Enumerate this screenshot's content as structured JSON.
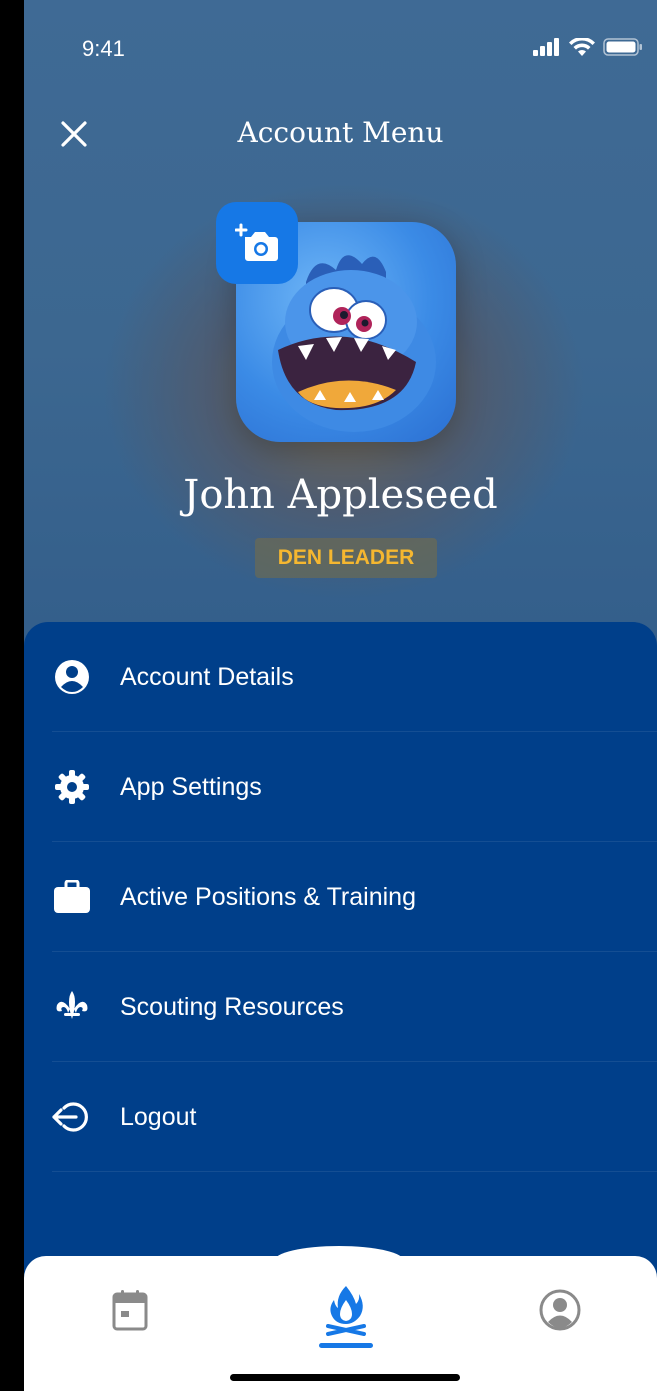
{
  "status_bar": {
    "time": "9:41"
  },
  "header": {
    "title": "Account Menu"
  },
  "profile": {
    "name": "John Appleseed",
    "role": "DEN LEADER"
  },
  "menu": {
    "items": [
      {
        "label": "Account Details",
        "icon": "account-circle-icon"
      },
      {
        "label": "App Settings",
        "icon": "gear-icon"
      },
      {
        "label": "Active Positions & Training",
        "icon": "briefcase-icon"
      },
      {
        "label": "Scouting Resources",
        "icon": "fleur-de-lis-icon"
      },
      {
        "label": "Logout",
        "icon": "logout-icon"
      }
    ]
  },
  "tabs": [
    {
      "icon": "calendar-icon",
      "active": false
    },
    {
      "icon": "campfire-icon",
      "active": true
    },
    {
      "icon": "profile-icon",
      "active": false
    }
  ],
  "colors": {
    "accent": "#1678e6",
    "panel": "#003f8a",
    "role": "#f5b730"
  }
}
